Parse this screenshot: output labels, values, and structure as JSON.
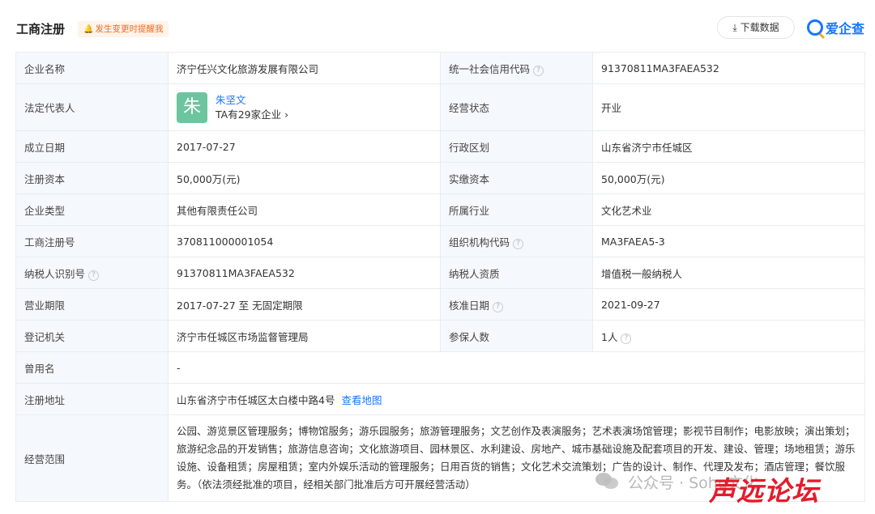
{
  "header": {
    "title": "工商注册",
    "remind_label": "发生变更时提醒我",
    "download_label": "下载数据",
    "brand_name": "爱企查"
  },
  "rows": {
    "company_name": {
      "label": "企业名称",
      "value": "济宁任兴文化旅游发展有限公司"
    },
    "credit_code": {
      "label": "统一社会信用代码",
      "value": "91370811MA3FAEA532"
    },
    "legal_rep": {
      "label": "法定代表人",
      "avatar_char": "朱",
      "name": "朱坚文",
      "sub": "TA有29家企业 ›"
    },
    "status": {
      "label": "经营状态",
      "value": "开业"
    },
    "founded": {
      "label": "成立日期",
      "value": "2017-07-27"
    },
    "district": {
      "label": "行政区划",
      "value": "山东省济宁市任城区"
    },
    "reg_capital": {
      "label": "注册资本",
      "value": "50,000万(元)"
    },
    "paid_capital": {
      "label": "实缴资本",
      "value": "50,000万(元)"
    },
    "company_type": {
      "label": "企业类型",
      "value": "其他有限责任公司"
    },
    "industry": {
      "label": "所属行业",
      "value": "文化艺术业"
    },
    "reg_number": {
      "label": "工商注册号",
      "value": "370811000001054"
    },
    "org_code": {
      "label": "组织机构代码",
      "value": "MA3FAEA5-3"
    },
    "taxpayer_id": {
      "label": "纳税人识别号",
      "value": "91370811MA3FAEA532"
    },
    "taxpayer_qual": {
      "label": "纳税人资质",
      "value": "增值税一般纳税人"
    },
    "term": {
      "label": "营业期限",
      "value": "2017-07-27 至 无固定期限"
    },
    "approval_date": {
      "label": "核准日期",
      "value": "2021-09-27"
    },
    "authority": {
      "label": "登记机关",
      "value": "济宁市任城区市场监督管理局"
    },
    "insured": {
      "label": "参保人数",
      "value": "1人"
    },
    "former_name": {
      "label": "曾用名",
      "value": "-"
    },
    "address": {
      "label": "注册地址",
      "value": "山东省济宁市任城区太白楼中路4号",
      "map_link": "查看地图"
    },
    "scope": {
      "label": "经营范围",
      "value": "公园、游览景区管理服务；博物馆服务；游乐园服务；旅游管理服务；文艺创作及表演服务；艺术表演场馆管理；影视节目制作；电影放映；演出策划；旅游纪念品的开发销售；旅游信息咨询；文化旅游项目、园林景区、水利建设、房地产、城市基础设施及配套项目的开发、建设、管理；场地租赁；游乐设施、设备租赁；房屋租赁；室内外娱乐活动的管理服务；日用百货的销售；文化艺术交流策划；广告的设计、制作、代理及发布；酒店管理；餐饮服务。（依法须经批准的项目，经相关部门批准后方可开展经营活动）"
    }
  },
  "watermark": {
    "text": "公众号 · Sohu文化",
    "logo": "声远论坛"
  },
  "colors": {
    "accent": "#1677ff",
    "label_bg": "#f5f8fc",
    "remind": "#f06b1e",
    "avatar": "#6cc59f",
    "watermark_logo": "#e31c2c"
  }
}
